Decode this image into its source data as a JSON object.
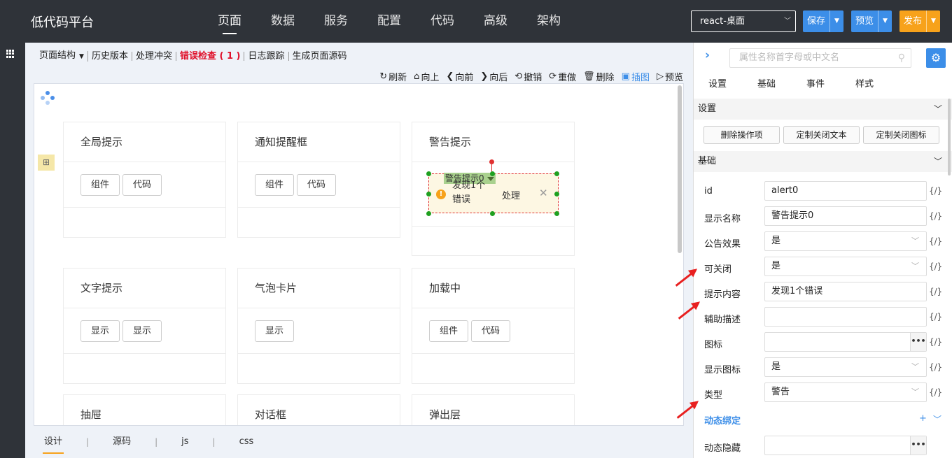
{
  "app": {
    "title": "低代码平台"
  },
  "nav": [
    "页面",
    "数据",
    "服务",
    "配置",
    "代码",
    "高级",
    "架构"
  ],
  "env_select": {
    "value": "react-桌面"
  },
  "top_buttons": {
    "save": "保存",
    "preview": "预览",
    "publish": "发布"
  },
  "subtoolbar": {
    "page_structure": "页面结构",
    "history": "历史版本",
    "conflict": "处理冲突",
    "error_check": "错误检查 ( 1 )",
    "log": "日志跟踪",
    "gen_source": "生成页面源码"
  },
  "actions": [
    "刷新",
    "向上",
    "向前",
    "向后",
    "撤销",
    "重做",
    "删除",
    "插图",
    "预览"
  ],
  "cards": [
    {
      "title": "全局提示",
      "buttons": [
        "组件",
        "代码"
      ]
    },
    {
      "title": "通知提醒框",
      "buttons": [
        "组件",
        "代码"
      ]
    },
    {
      "title": "警告提示",
      "buttons": []
    },
    {
      "title": "文字提示",
      "buttons": [
        "显示",
        "显示"
      ]
    },
    {
      "title": "气泡卡片",
      "buttons": [
        "显示"
      ]
    },
    {
      "title": "加载中",
      "buttons": [
        "组件",
        "代码"
      ]
    },
    {
      "title": "抽屉",
      "buttons": []
    },
    {
      "title": "对话框",
      "buttons": []
    },
    {
      "title": "弹出层",
      "buttons": []
    }
  ],
  "alert_widget": {
    "tag": "警告提示0",
    "message": "发现1个错误",
    "action": "处理",
    "close": "✕"
  },
  "bottom_tabs": [
    "设计",
    "源码",
    "js",
    "css"
  ],
  "right_panel": {
    "search_placeholder": "属性名称首字母或中文名",
    "tabs": [
      "设置",
      "基础",
      "事件",
      "样式"
    ],
    "section_settings": "设置",
    "setting_buttons": [
      "删除操作项",
      "定制关闭文本",
      "定制关闭图标"
    ],
    "section_basic": "基础",
    "fx": "{/}",
    "props": [
      {
        "label": "id",
        "value": "alert0",
        "kind": "text"
      },
      {
        "label": "显示名称",
        "value": "警告提示0",
        "kind": "text"
      },
      {
        "label": "公告效果",
        "value": "是",
        "kind": "select"
      },
      {
        "label": "可关闭",
        "value": "是",
        "kind": "select"
      },
      {
        "label": "提示内容",
        "value": "发现1个错误",
        "kind": "text"
      },
      {
        "label": "辅助描述",
        "value": "",
        "kind": "text"
      },
      {
        "label": "图标",
        "value": "",
        "kind": "more"
      },
      {
        "label": "显示图标",
        "value": "是",
        "kind": "select"
      },
      {
        "label": "类型",
        "value": "警告",
        "kind": "select"
      }
    ],
    "dynamic_binding": "动态绑定",
    "dynamic_hidden": "动态隐藏"
  },
  "colors": {
    "accent": "#3c8ee8",
    "publish": "#f7a21b",
    "error": "#e0102a",
    "topbar": "#2f3339"
  }
}
